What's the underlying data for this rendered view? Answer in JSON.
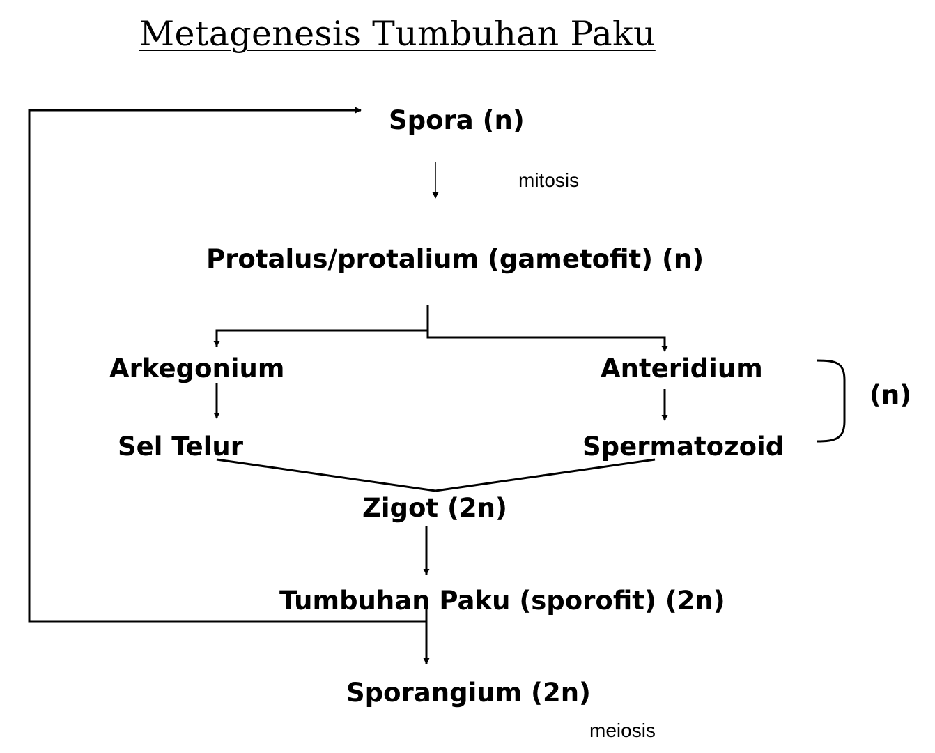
{
  "title": "Metagenesis Tumbuhan Paku",
  "nodes": {
    "spora": "Spora (n)",
    "protalus": "Protalus/protalium (gametofit)  (n)",
    "arkegonium": "Arkegonium",
    "anteridium": "Anteridium",
    "sel_telur": "Sel Telur",
    "spermatozoid": "Spermatozoid",
    "zigot": "Zigot (2n)",
    "tumbuhan_paku": "Tumbuhan Paku (sporofit) (2n)",
    "sporangium": "Sporangium (2n)"
  },
  "annotations": {
    "mitosis": "mitosis",
    "meiosis": "meiosis",
    "haploid_group": "(n)"
  }
}
